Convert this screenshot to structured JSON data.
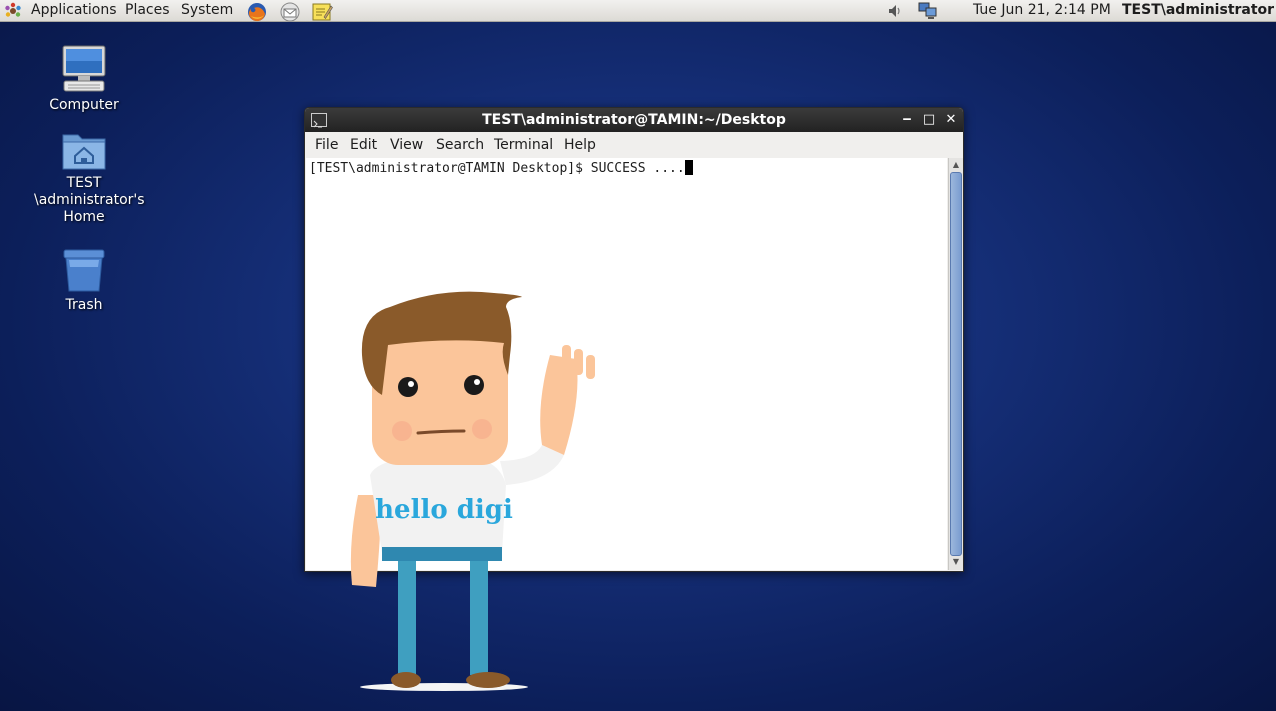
{
  "panel": {
    "menus": [
      "Applications",
      "Places",
      "System"
    ],
    "launchers": [
      "firefox-icon",
      "email-icon",
      "text-editor-icon"
    ],
    "tray": [
      "volume-icon",
      "network-icon"
    ],
    "clock": "Tue Jun 21,  2:14 PM",
    "user": "TEST\\administrator"
  },
  "desktop": {
    "icons": [
      {
        "label": "Computer",
        "icon": "computer-icon"
      },
      {
        "label": "TEST\n\\administrator's\nHome",
        "icon": "home-folder-icon"
      },
      {
        "label": "Trash",
        "icon": "trash-icon"
      }
    ]
  },
  "terminal": {
    "title": "TEST\\administrator@TAMIN:~/Desktop",
    "menu": [
      "File",
      "Edit",
      "View",
      "Search",
      "Terminal",
      "Help"
    ],
    "line": "[TEST\\administrator@TAMIN Desktop]$ SUCCESS ...."
  },
  "mascot": {
    "shirt_text": "hello digi"
  },
  "colors": {
    "desktop_background": "#0c1f5a",
    "titlebar": "#2b2b2b",
    "scrollbar_thumb": "#7a9cd0",
    "shirt_text": "#2aa7dc"
  }
}
